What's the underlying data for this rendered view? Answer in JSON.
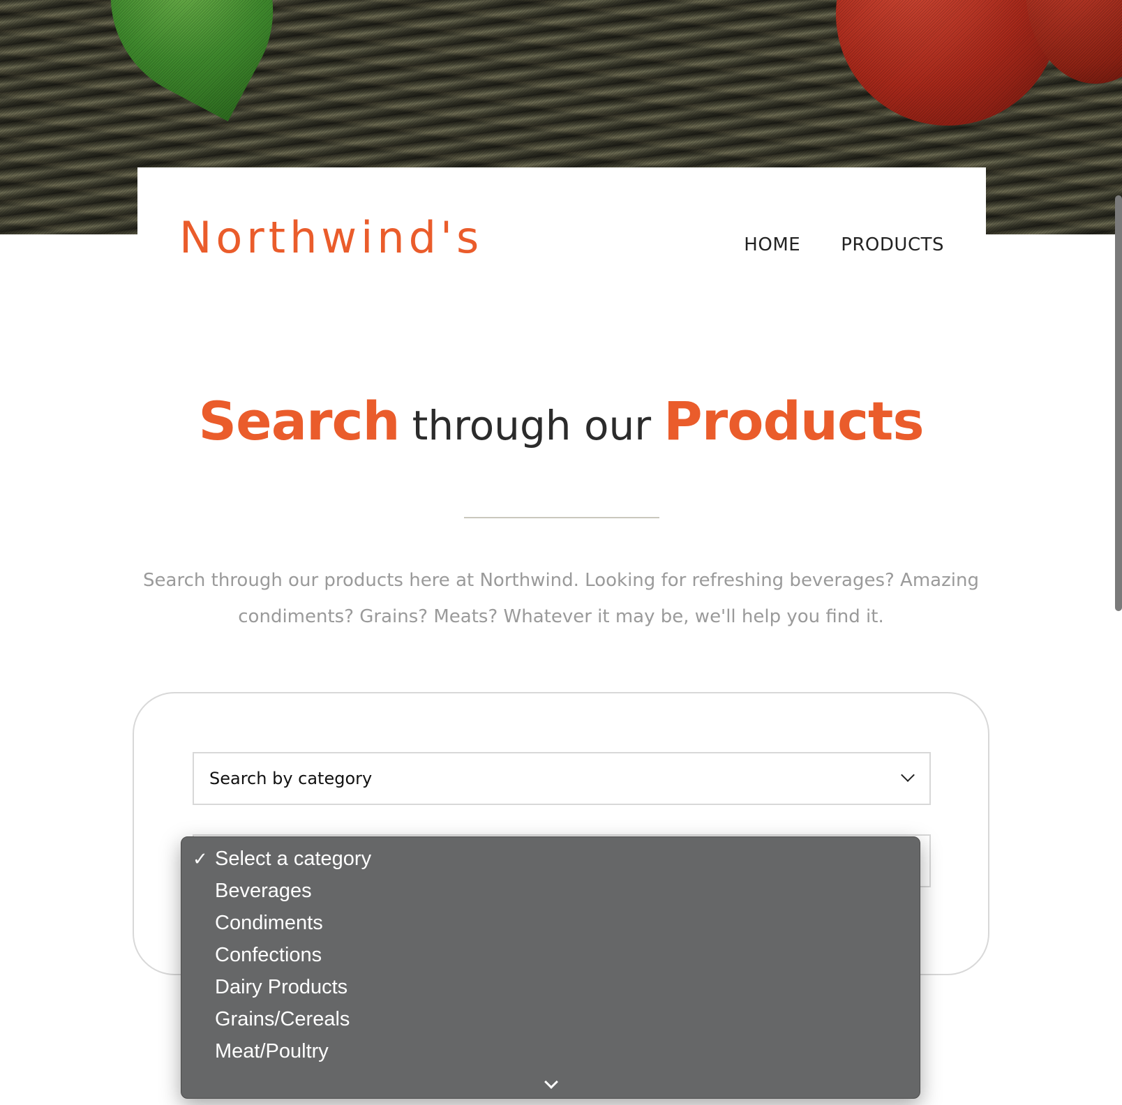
{
  "brand": {
    "name": "Northwind's"
  },
  "nav": {
    "items": [
      {
        "label": "HOME"
      },
      {
        "label": "PRODUCTS"
      }
    ]
  },
  "heading": {
    "word1": "Search",
    "middle": "through our",
    "word2": "Products"
  },
  "intro": {
    "text": "Search through our products here at Northwind. Looking for refreshing beverages? Amazing condiments? Grains? Meats? Whatever it may be, we'll help you find it."
  },
  "search": {
    "mode_select": {
      "value": "Search by category"
    },
    "category_select": {
      "selected": "Select a category",
      "options": [
        "Select a category",
        "Beverages",
        "Condiments",
        "Confections",
        "Dairy Products",
        "Grains/Cereals",
        "Meat/Poultry"
      ]
    }
  },
  "colors": {
    "accent": "#ea5c2b",
    "text_dark": "#2b2b2b",
    "muted": "#9a9a9a",
    "menu_bg": "#666768"
  },
  "icons": {
    "selected_marker": "checkmark-icon",
    "select_arrow": "chevron-down-icon",
    "scroll_more": "chevron-down-icon"
  }
}
